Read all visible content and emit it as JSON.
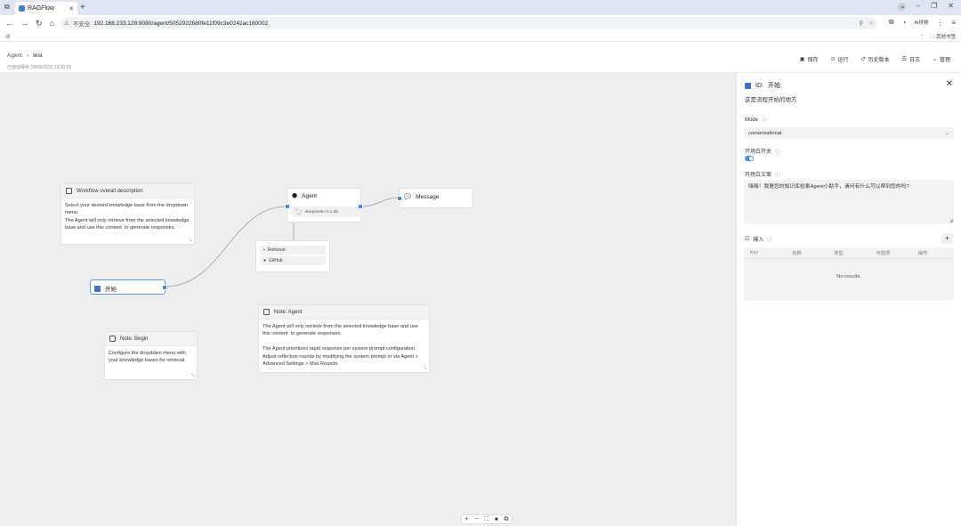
{
  "browser": {
    "tab_title": "RAGFlow",
    "url_warning": "不安全",
    "url": "192.168.233.128:9080/agent/5052922680fe11f09c3e0242ac160002",
    "translate_label": "Ai拼物",
    "bookmarks_label": "其他书签"
  },
  "header": {
    "breadcrumb_root": "Agent",
    "breadcrumb_current": "test",
    "saved_text": "已自动保存 24/09/2025 23:10:03",
    "actions": [
      {
        "icon": "save-icon",
        "label": "保存"
      },
      {
        "icon": "play-icon",
        "label": "运行"
      },
      {
        "icon": "history-icon",
        "label": "历史版本"
      },
      {
        "icon": "log-icon",
        "label": "日志"
      },
      {
        "icon": "chevron-down-icon",
        "label": "管理"
      }
    ]
  },
  "canvas": {
    "notes": {
      "workflow": {
        "title": "Workflow overall description",
        "body": "Select your desired knowledge base from the dropdown menu.\nThe Agent will only retrieve from the selected knowledge base and use this content  to generate responses."
      },
      "begin": {
        "title": "Note: Begin",
        "body": "Configure the dropdown menu with your knowledge bases for retrieval."
      },
      "agent": {
        "title": "Note: Agent",
        "body": "The Agent will only retrieve from the selected knowledge base and use this content  to generate responses.\n\nThe Agent prioritizes rapid response per system prompt configuration. Adjust reflection rounds by modifying the system prompt or via Agent > Advanced Settings > Max Rounds."
      }
    },
    "nodes": {
      "begin": {
        "label": "开始"
      },
      "agent": {
        "label": "Agent",
        "model": "deepseek-r1:1.5b"
      },
      "message": {
        "label": "Message"
      },
      "tools": [
        "Retrieval",
        "GitHub"
      ]
    },
    "zoom_controls": [
      "+",
      "−",
      "⛶",
      "🔒",
      "⧉"
    ]
  },
  "panel": {
    "title_id": "ID:",
    "title_name": "开始",
    "description": "这是流程开始的地方",
    "mode_label": "Mode",
    "mode_value": "conversational",
    "opening_toggle_label": "开场白开关",
    "opening_label": "开场白文案",
    "opening_text": "嗨嗨！我是您的知识库检索Agent小助手，请问有什么可以帮到您的吗?",
    "inputs_label": "输入",
    "inputs_add": "+",
    "table_headers": [
      "Key",
      "名称",
      "类型",
      "可选项",
      "操作"
    ],
    "no_results": "No results."
  },
  "colors": {
    "accent": "#3d8bf2",
    "canvas_bg": "#eeeeee"
  }
}
